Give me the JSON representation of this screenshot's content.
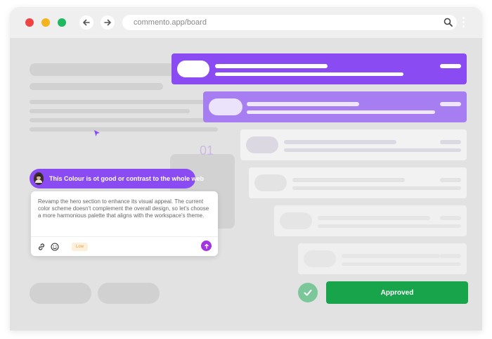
{
  "browser": {
    "url": "commento.app/board"
  },
  "comment": {
    "tag_text": "This Colour is ot good or contrast to the whole web",
    "body": "Revamp the hero section to enhance its visual appeal. The current color scheme doesn't complement the overall design, so let's choose a more harmonious palette that aligns with the workspace's theme.",
    "priority": "Low"
  },
  "ghost_number": "01",
  "actions": {
    "approved_label": "Approved"
  },
  "colors": {
    "accent": "#8a4bf2",
    "accent_light": "#a77df2",
    "success": "#18a44a"
  }
}
